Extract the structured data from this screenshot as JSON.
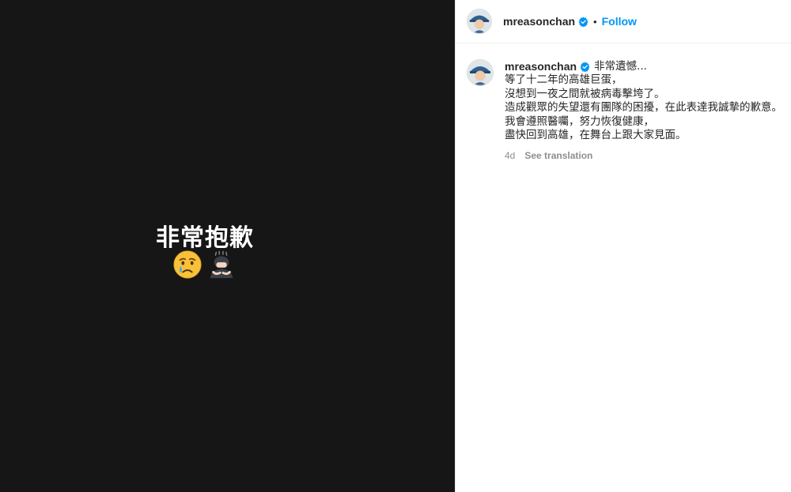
{
  "post": {
    "media": {
      "text": "非常抱歉",
      "emojis": [
        "crying-face",
        "person-bowing"
      ]
    },
    "header": {
      "username": "mreasonchan",
      "separator": "•",
      "follow_label": "Follow"
    },
    "caption": {
      "username": "mreasonchan",
      "first_line": "非常遺憾...",
      "lines": [
        "等了十二年的高雄巨蛋，",
        "沒想到一夜之間就被病毒擊垮了。",
        "造成觀眾的失望還有團隊的困擾，在此表達我誠摯的歉意。",
        "我會遵照醫囑，努力恢復健康，",
        "盡快回到高雄，在舞台上跟大家見面。"
      ],
      "time": "4d",
      "translate_label": "See translation"
    },
    "colors": {
      "accent": "#0095f6",
      "verified": "#0095f6",
      "media_bg": "#161616"
    }
  }
}
